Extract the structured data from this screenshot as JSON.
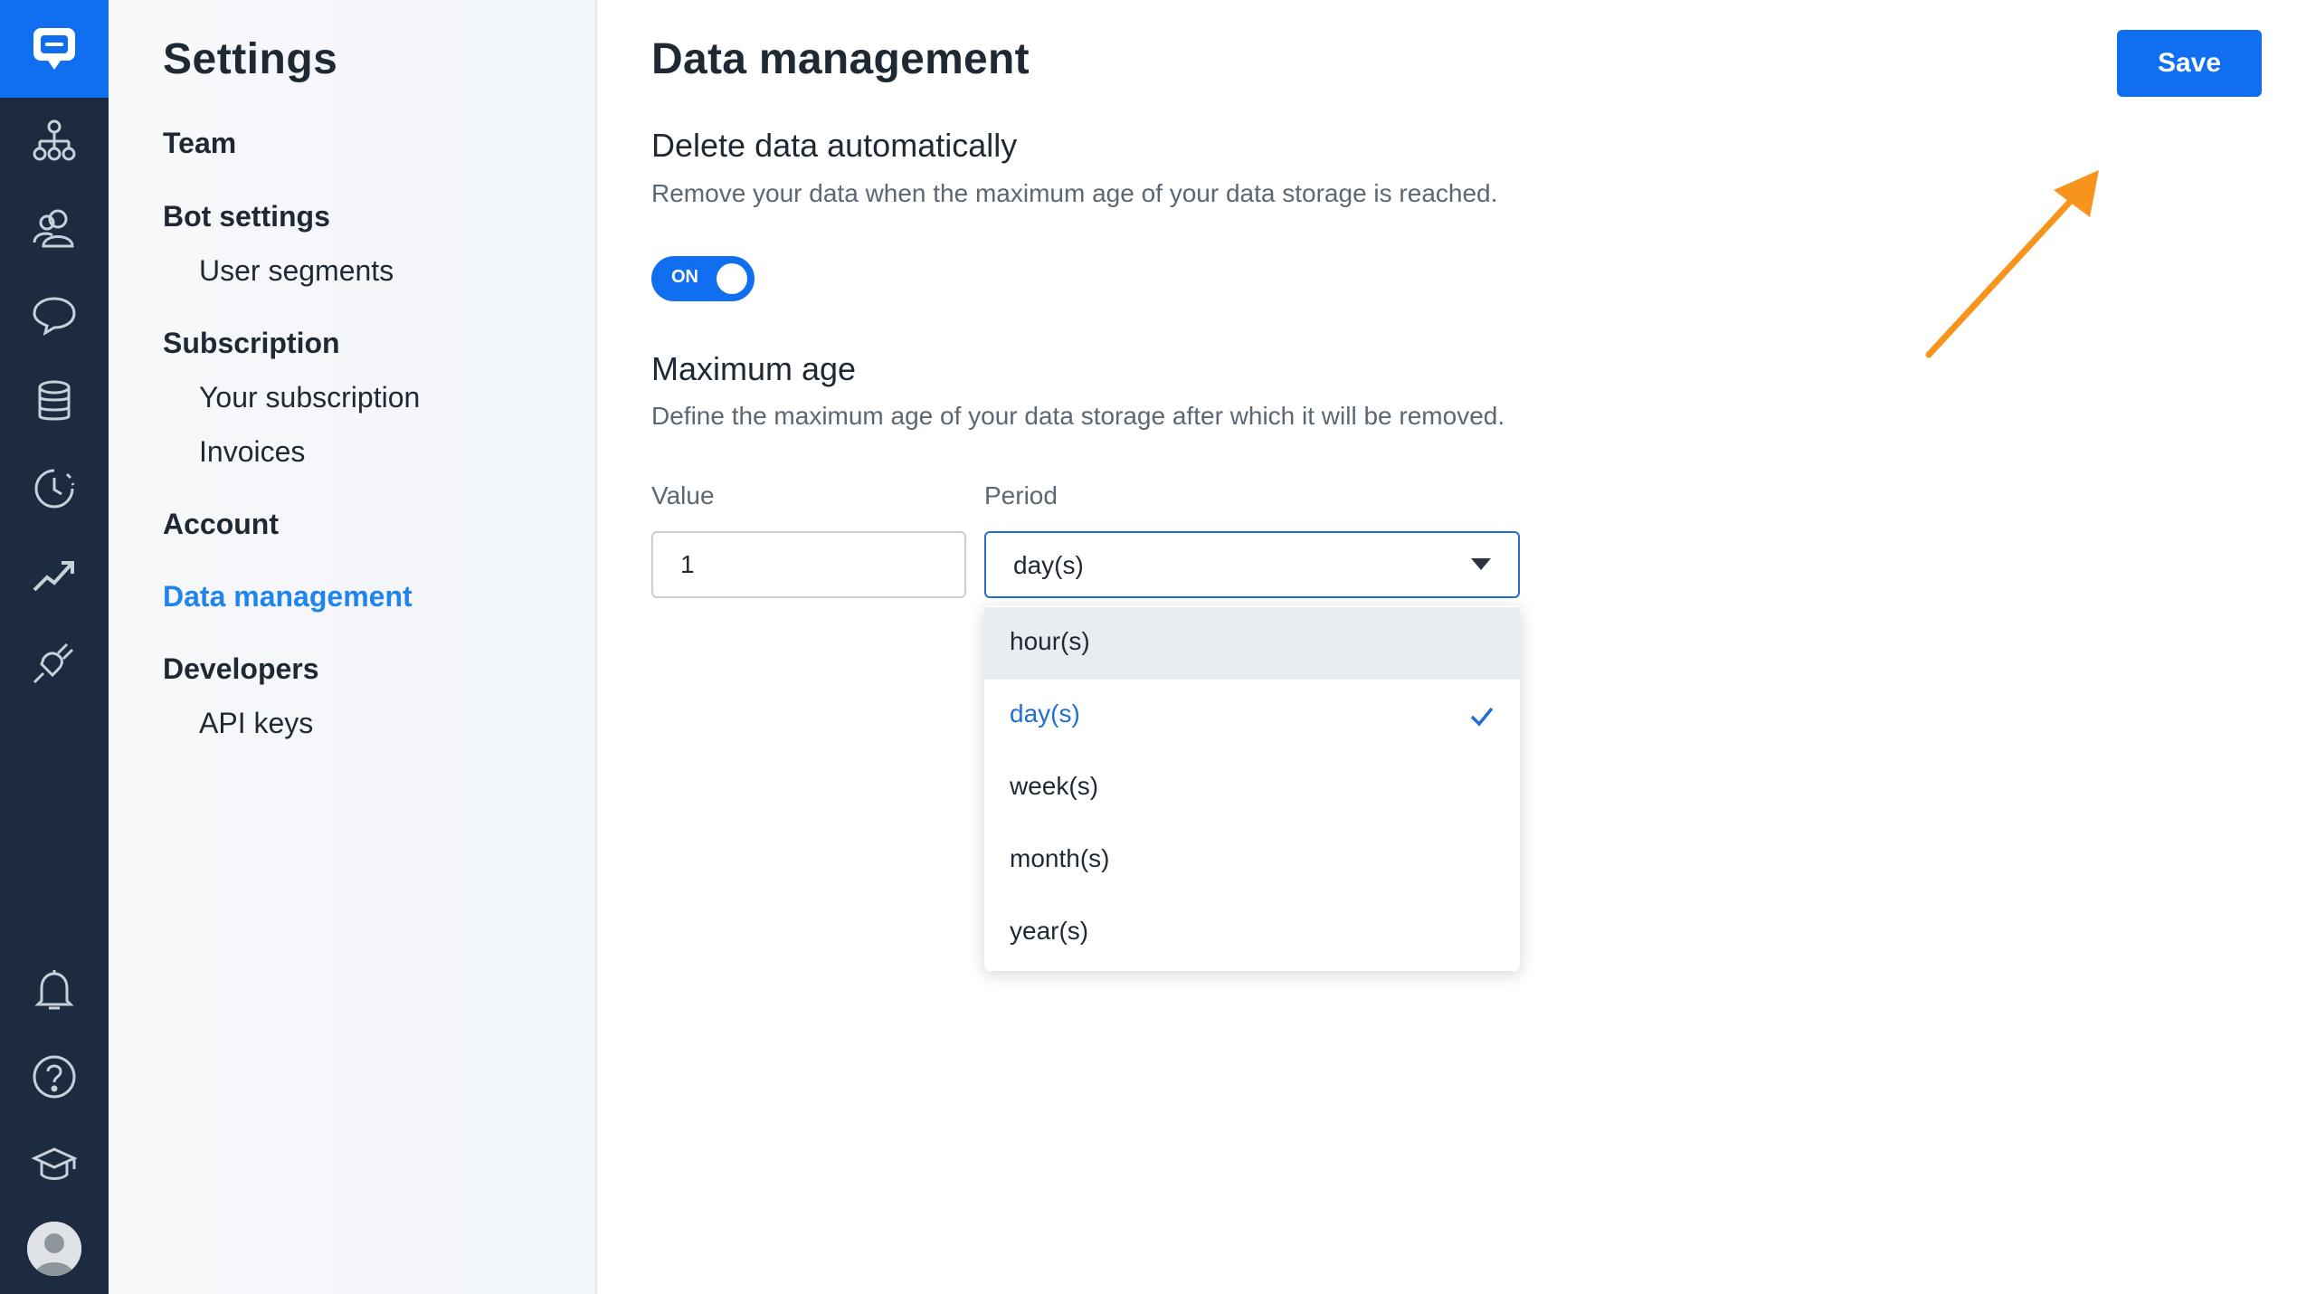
{
  "rail": {
    "icons": [
      "chat-logo-icon",
      "org-chart-icon",
      "users-icon",
      "chat-bubble-icon",
      "database-icon",
      "history-icon",
      "trending-icon",
      "plug-icon",
      "bell-icon",
      "help-icon",
      "graduation-cap-icon",
      "avatar"
    ]
  },
  "sidebar": {
    "title": "Settings",
    "items": [
      {
        "label": "Team"
      },
      {
        "label": "Bot settings"
      },
      {
        "label": "User segments"
      },
      {
        "label": "Subscription"
      },
      {
        "label": "Your subscription"
      },
      {
        "label": "Invoices"
      },
      {
        "label": "Account"
      },
      {
        "label": "Data management"
      },
      {
        "label": "Developers"
      },
      {
        "label": "API keys"
      }
    ]
  },
  "main": {
    "title": "Data management",
    "save_label": "Save",
    "delete_section": {
      "heading": "Delete data automatically",
      "description": "Remove your data when the maximum age of your data storage is reached.",
      "toggle_label": "ON"
    },
    "max_age_section": {
      "heading": "Maximum age",
      "description": "Define the maximum age of your data storage after which it will be removed.",
      "value_label": "Value",
      "value": "1",
      "period_label": "Period",
      "period_value": "day(s)",
      "options": [
        "hour(s)",
        "day(s)",
        "week(s)",
        "month(s)",
        "year(s)"
      ]
    }
  },
  "colors": {
    "accent": "#0f6ff0",
    "rail": "#1c2b40",
    "annotation_arrow": "#f7941d"
  }
}
